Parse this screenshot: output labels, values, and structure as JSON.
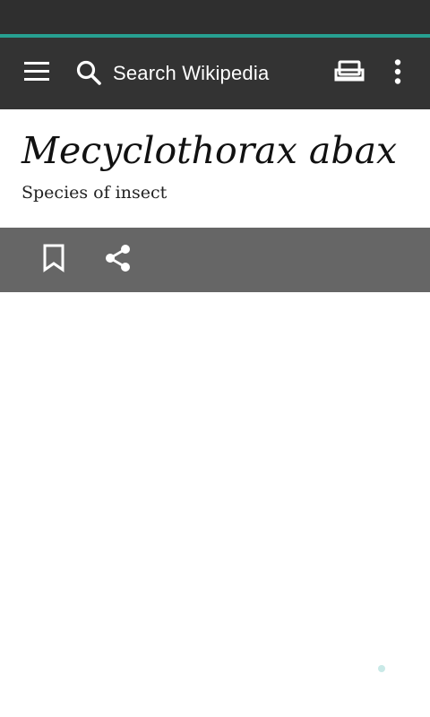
{
  "toolbar": {
    "search_label": "Search Wikipedia",
    "icons": {
      "menu": "menu-icon",
      "search": "search-icon",
      "tabs": "tabs-icon",
      "overflow": "overflow-icon"
    }
  },
  "article": {
    "title": "Mecyclothorax abax",
    "description": "Species of insect"
  },
  "actions": {
    "icons": [
      "bookmark-icon",
      "share-icon"
    ]
  },
  "colors": {
    "status_bar": "#2f2f2f",
    "toolbar": "#333333",
    "accent": "#27a091",
    "action_bar": "#666666"
  }
}
